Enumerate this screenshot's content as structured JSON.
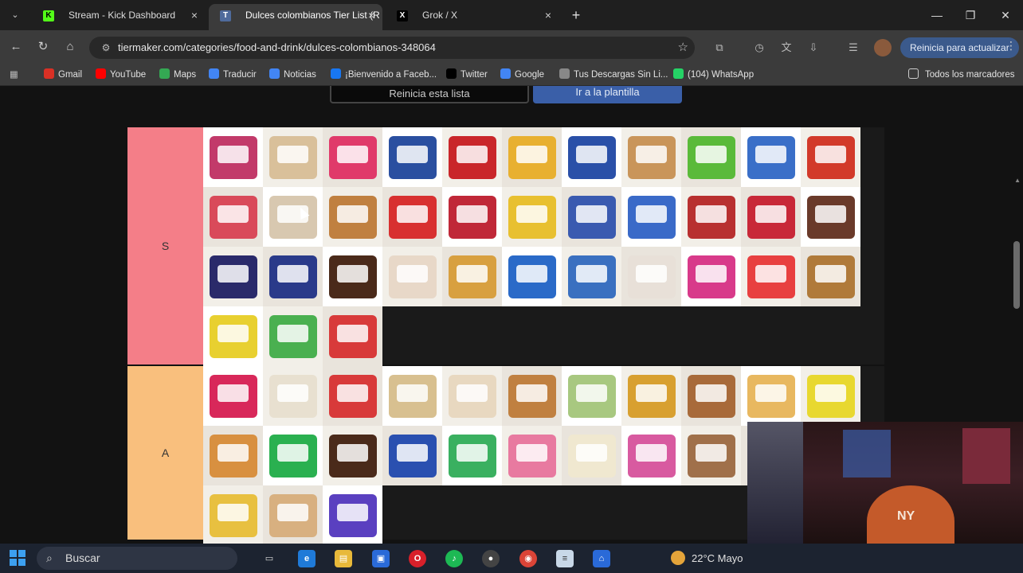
{
  "tabs": [
    {
      "title": "Stream - Kick Dashboard",
      "favicon": "K",
      "color": "#53fc18",
      "active": false
    },
    {
      "title": "Dulces colombianos Tier List (R",
      "favicon": "T",
      "color": "#4f6b9c",
      "active": true
    },
    {
      "title": "Grok / X",
      "favicon": "X",
      "color": "#000000",
      "active": false
    }
  ],
  "toolbar": {
    "url": "tiermaker.com/categories/food-and-drink/dulces-colombianos-348064",
    "update_label": "Reinicia para actualizar"
  },
  "bookmarks": [
    {
      "label": "Gmail",
      "icon": "gmail-icon",
      "color": "#d93025"
    },
    {
      "label": "YouTube",
      "icon": "youtube-icon",
      "color": "#ff0000"
    },
    {
      "label": "Maps",
      "icon": "maps-icon",
      "color": "#34a853"
    },
    {
      "label": "Traducir",
      "icon": "translate-icon",
      "color": "#4285f4"
    },
    {
      "label": "Noticias",
      "icon": "news-icon",
      "color": "#4285f4"
    },
    {
      "label": "¡Bienvenido a Faceb...",
      "icon": "facebook-icon",
      "color": "#1877f2"
    },
    {
      "label": "Twitter",
      "icon": "x-icon",
      "color": "#000000"
    },
    {
      "label": "Google",
      "icon": "google-icon",
      "color": "#4285f4"
    },
    {
      "label": "Tus Descargas Sin Li...",
      "icon": "globe-icon",
      "color": "#888888"
    },
    {
      "label": "(104) WhatsApp",
      "icon": "whatsapp-icon",
      "color": "#25d366"
    }
  ],
  "bookmarks_all": "Todos los marcadores",
  "page": {
    "restart_label": "Reinicia esta lista",
    "template_label": "Ir a la plantilla"
  },
  "tiers": [
    {
      "label": "S",
      "color": "#f47e88",
      "height": 300,
      "items": [
        "#c23a6a",
        "#d9c09a",
        "#e03a6a",
        "#2a4fa0",
        "#c9262a",
        "#e8b030",
        "#2a50a8",
        "#c9955a",
        "#5aba3a",
        "#3a6fc8",
        "#d23a2a",
        "#d94a5a",
        "#d8c8b0",
        "#c08040",
        "#d83030",
        "#c02838",
        "#e8c030",
        "#3a5ab0",
        "#3a6ac8",
        "#b83030",
        "#c82838",
        "#6a3a2a",
        "#2a2a6a",
        "#2a3a8a",
        "#4a2a1a",
        "#e8d8c8",
        "#d8a040",
        "#2a6ac8",
        "#3a70c0",
        "#e8e0d8",
        "#d83a8a",
        "#e84040",
        "#b07a3a",
        "#e8d030",
        "#4ab050",
        "#d83a3a"
      ]
    },
    {
      "label": "A",
      "color": "#f9bf7d",
      "height": 220,
      "items": [
        "#d8285a",
        "#e8e0d0",
        "#d83a3a",
        "#d8c090",
        "#e8d8c0",
        "#c08040",
        "#a8c880",
        "#d8a030",
        "#a86a3a",
        "#e8b860",
        "#e8d830",
        "#d89040",
        "#2ab050",
        "#4a2a1a",
        "#2a50b0",
        "#3ab060",
        "#e87aa0",
        "#f0e8d0",
        "#d85aa0",
        "#a0704a",
        "#e8a8c0",
        "#c02838",
        "#e8c040",
        "#d8b080",
        "#5a40c0"
      ]
    }
  ],
  "taskbar": {
    "search_label": "Buscar",
    "weather": "22°C  Mayo"
  }
}
